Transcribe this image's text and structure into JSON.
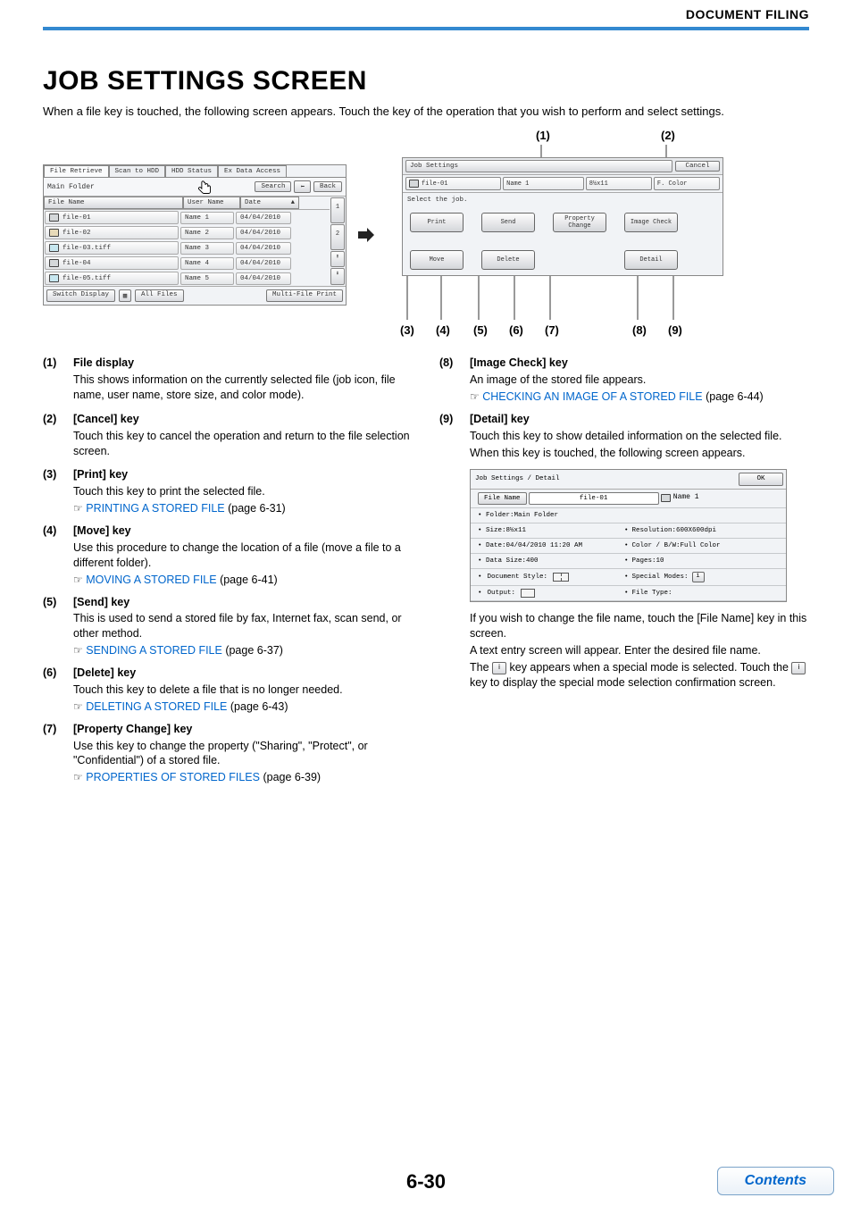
{
  "header": {
    "section": "DOCUMENT FILING"
  },
  "title": "JOB SETTINGS SCREEN",
  "intro": "When a file key is touched, the following screen appears. Touch the key of the operation that you wish to perform and select settings.",
  "screen1": {
    "tabs": [
      "File Retrieve",
      "Scan to HDD",
      "HDD Status",
      "Ex Data Access"
    ],
    "folder": "Main Folder",
    "search": "Search",
    "back": "Back",
    "backArrow": "⬅",
    "headers": {
      "file": "File Name",
      "user": "User Name",
      "date": "Date",
      "sort": "▲"
    },
    "files": [
      {
        "icon": "print",
        "name": "file-01",
        "user": "Name 1",
        "date": "04/04/2010"
      },
      {
        "icon": "copy",
        "name": "file-02",
        "user": "Name 2",
        "date": "04/04/2010"
      },
      {
        "icon": "scan",
        "name": "file-03.tiff",
        "user": "Name 3",
        "date": "04/04/2010"
      },
      {
        "icon": "print",
        "name": "file-04",
        "user": "Name 4",
        "date": "04/04/2010"
      },
      {
        "icon": "scan",
        "name": "file-05.tiff",
        "user": "Name 5",
        "date": "04/04/2010"
      }
    ],
    "pager": {
      "page": "1",
      "total": "2",
      "up": "⬆",
      "down": "⬇"
    },
    "switch": "Switch Display",
    "all": "All Files",
    "multi": "Multi-File Print"
  },
  "screen2": {
    "title": "Job Settings",
    "cancel": "Cancel",
    "file": "file-01",
    "user": "Name 1",
    "size": "8½x11",
    "color": "F. Color",
    "msg": "Select the job.",
    "buttons": {
      "print": "Print",
      "send": "Send",
      "property": "Property Change",
      "image": "Image Check",
      "move": "Move",
      "delete": "Delete",
      "detail": "Detail"
    },
    "callouts": {
      "c1": "(1)",
      "c2": "(2)",
      "c3": "(3)",
      "c4": "(4)",
      "c5": "(5)",
      "c6": "(6)",
      "c7": "(7)",
      "c8": "(8)",
      "c9": "(9)"
    }
  },
  "desc": {
    "i1": {
      "t": "File display",
      "d": "This shows information on the currently selected file (job icon, file name, user name, store size, and color mode)."
    },
    "i2": {
      "t": "[Cancel] key",
      "d": "Touch this key to cancel the operation and return to the file selection screen."
    },
    "i3": {
      "t": "[Print] key",
      "d": "Touch this key to print the selected file.",
      "l": "PRINTING A STORED FILE",
      "p": " (page 6-31)"
    },
    "i4": {
      "t": "[Move] key",
      "d": "Use this procedure to change the location of a file (move a file to a different folder).",
      "l": "MOVING A STORED FILE",
      "p": " (page 6-41)"
    },
    "i5": {
      "t": "[Send] key",
      "d": "This is used to send a stored file by fax, Internet fax, scan send, or other method.",
      "l": "SENDING A STORED FILE",
      "p": " (page 6-37)"
    },
    "i6": {
      "t": "[Delete] key",
      "d": "Touch this key to delete a file that is no longer needed.",
      "l": "DELETING A STORED FILE",
      "p": " (page 6-43)"
    },
    "i7": {
      "t": "[Property Change] key",
      "d": "Use this key to change the property (\"Sharing\", \"Protect\", or \"Confidential\") of a stored file.",
      "l": "PROPERTIES OF STORED FILES",
      "p": " (page 6-39)"
    },
    "i8": {
      "t": "[Image Check] key",
      "d": "An image of the stored file appears.",
      "l": "CHECKING AN IMAGE OF A STORED FILE",
      "p": " (page 6-44)"
    },
    "i9": {
      "t": "[Detail] key",
      "d1": "Touch this key to show detailed information on the selected file.",
      "d2": "When this key is touched, the following screen appears."
    }
  },
  "detail": {
    "title": "Job Settings / Detail",
    "ok": "OK",
    "fnLabel": "File Name",
    "fnVal": "file-01",
    "fnUser": "Name 1",
    "folder": "Folder:Main Folder",
    "size": "Size:8½x11",
    "res": "Resolution:600X600dpi",
    "date": "Date:04/04/2010 11:20 AM",
    "colorbw": "Color / B/W:Full Color",
    "dsize": "Data Size:400",
    "pages": "Pages:10",
    "dstyle": "Document Style:",
    "special": "Special Modes:",
    "output": "Output:",
    "ftype": "File Type:",
    "info": "i"
  },
  "post": {
    "p1": "If you wish to change the file name, touch the [File Name] key in this screen.",
    "p2": "A text entry screen will appear. Enter the desired file name.",
    "p3a": "The ",
    "p3b": " key appears when a special mode is selected. Touch the ",
    "p3c": " key to display the special mode selection confirmation screen."
  },
  "page": "6-30",
  "contents": "Contents",
  "xref": "☞"
}
